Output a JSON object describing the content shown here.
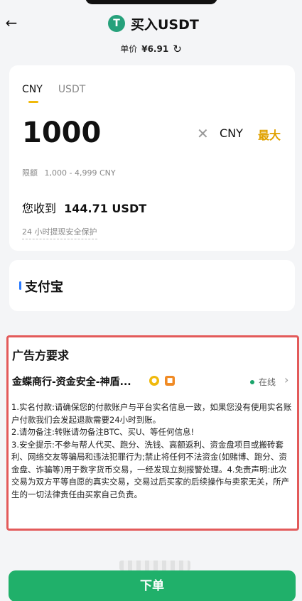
{
  "header": {
    "back_icon": "arrow-left-icon",
    "logo_icon": "tether-icon",
    "logo_letter": "T",
    "title": "买入USDT",
    "price_label": "单价",
    "price_value": "¥6.91",
    "refresh_icon": "refresh-icon"
  },
  "trade": {
    "tabs": [
      "CNY",
      "USDT"
    ],
    "active_tab": "CNY",
    "amount": "1000",
    "currency": "CNY",
    "max_label": "最大",
    "limit_label": "限额",
    "limit_value": "1,000 - 4,999 CNY",
    "receive_label": "您收到",
    "receive_value": "144.71 USDT",
    "protection_text": "24 小时提现安全保护"
  },
  "payment": {
    "method": "支付宝",
    "accent_color": "#2b7bff"
  },
  "ad": {
    "title": "广告方要求",
    "merchant_name": "金蝶商行-资金安全-神盾...",
    "status": "在线",
    "terms": [
      "1.实名付款:请确保您的付款账户与平台实名信息一致，如果您没有使用实名账户付款我们会发起退款需要24小时到账。",
      "2.请勿备注:转账请勿备注BTC、买U、等任何信息!",
      "3.安全提示:不参与帮人代买、跑分、洗钱、高额返利、资金盘项目或搬砖套利、网络交友等骗局和违法犯罪行为;禁止将任何不法资金(如赌博、跑分、资金盘、诈骗等)用于数字货币交易，一经发现立刻报警处理。4.免责声明:此次交易为双方平等自愿的真实交易，交易过后买家的后续操作与卖家无关，所产生的一切法律责任由买家自己负责。"
    ]
  },
  "footer": {
    "order_label": "下单",
    "button_color": "#20b06a"
  }
}
